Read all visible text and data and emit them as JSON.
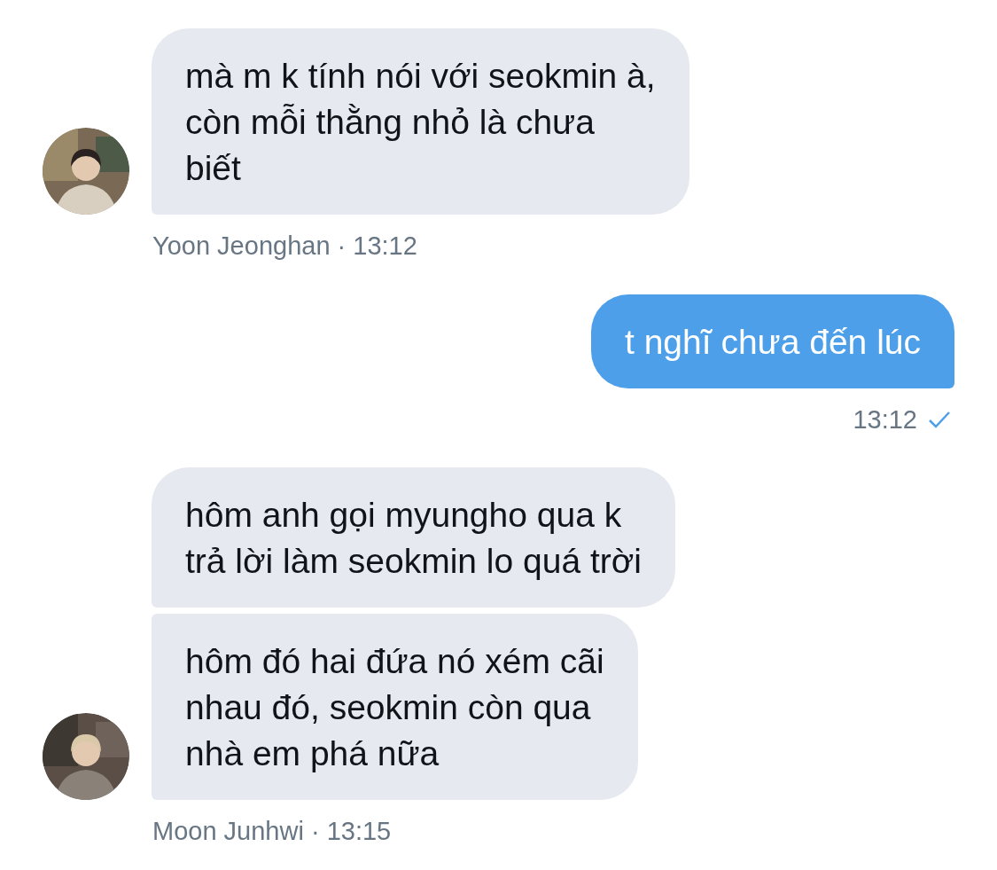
{
  "messages": [
    {
      "kind": "received",
      "bubbles": [
        {
          "lines": [
            "mà m k tính nói với seokmin à,",
            "còn mỗi thằng nhỏ là chưa",
            "biết"
          ]
        }
      ],
      "meta": "Yoon Jeonghan · 13:12"
    },
    {
      "kind": "sent",
      "bubbles": [
        {
          "lines": [
            "t nghĩ chưa đến lúc"
          ]
        }
      ],
      "meta": "13:12",
      "read": true
    },
    {
      "kind": "received",
      "bubbles": [
        {
          "lines": [
            "hôm anh gọi myungho qua k",
            "trả lời làm seokmin lo quá trời"
          ]
        },
        {
          "lines": [
            "hôm đó hai đứa nó xém cãi",
            "nhau đó, seokmin còn qua",
            "nhà em phá nữa"
          ]
        }
      ],
      "meta": "Moon Junhwi · 13:15"
    }
  ]
}
